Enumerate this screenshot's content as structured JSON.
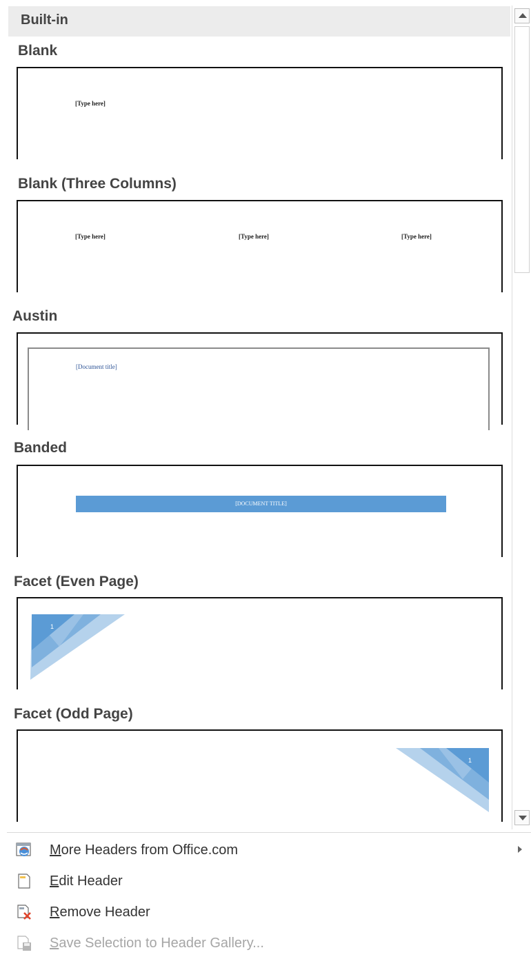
{
  "gallery": {
    "group_label": "Built-in",
    "items": [
      {
        "title": "Blank",
        "placeholders": [
          "[Type here]"
        ]
      },
      {
        "title": "Blank (Three Columns)",
        "placeholders": [
          "[Type here]",
          "[Type here]",
          "[Type here]"
        ]
      },
      {
        "title": "Austin",
        "placeholders": [
          "[Document title]"
        ]
      },
      {
        "title": "Banded",
        "placeholders": [
          "[DOCUMENT TITLE]"
        ]
      },
      {
        "title": "Facet (Even Page)",
        "page_number": "1"
      },
      {
        "title": "Facet (Odd Page)",
        "page_number": "1"
      }
    ]
  },
  "commands": [
    {
      "label_accel": "M",
      "label_rest": "ore Headers from Office.com",
      "icon": "office-web-icon",
      "has_submenu": true,
      "enabled": true
    },
    {
      "label_accel": "E",
      "label_rest": "dit Header",
      "icon": "edit-header-icon",
      "enabled": true
    },
    {
      "label_accel": "R",
      "label_rest": "emove Header",
      "icon": "remove-header-icon",
      "enabled": true
    },
    {
      "label_accel": "S",
      "label_rest": "ave Selection to Header Gallery...",
      "icon": "save-selection-icon",
      "enabled": false
    }
  ],
  "colors": {
    "accent": "#5b9bd5",
    "accent_dark": "#2f5597",
    "disabled_text": "#a6a6a6"
  }
}
